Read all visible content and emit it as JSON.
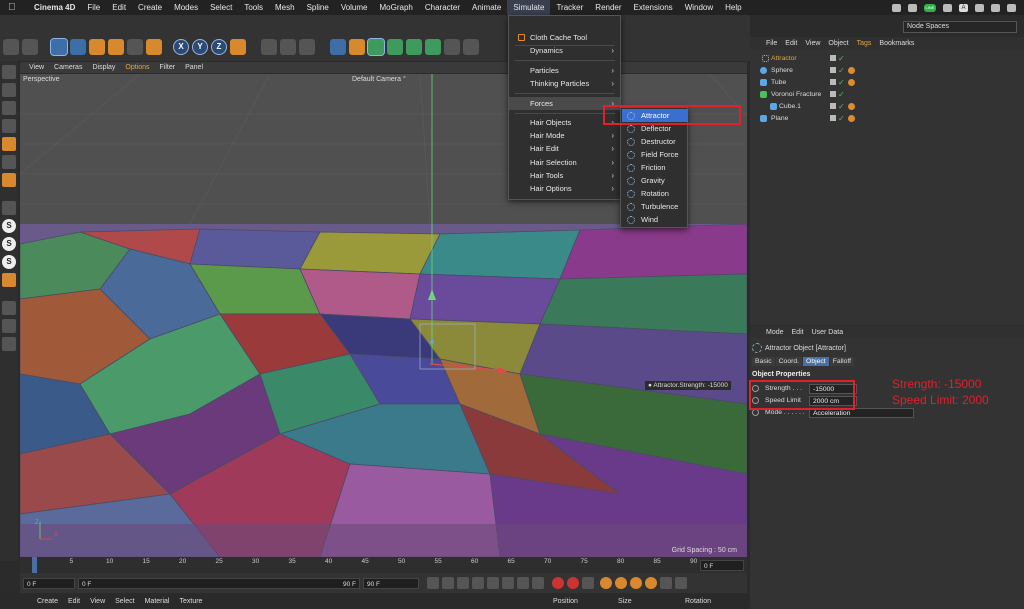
{
  "menubar": {
    "app": "Cinema 4D",
    "items": [
      "File",
      "Edit",
      "Create",
      "Modes",
      "Select",
      "Tools",
      "Mesh",
      "Spline",
      "Volume",
      "MoGraph",
      "Character",
      "Animate",
      "Simulate",
      "Tracker",
      "Render",
      "Extensions",
      "Window",
      "Help"
    ],
    "active": "Simulate",
    "badge_text": "LINE",
    "a_badge": "A"
  },
  "toolbar": {
    "axis_x": "X",
    "axis_y": "Y",
    "axis_z": "Z"
  },
  "node_spaces": "Node Spaces",
  "viewport": {
    "menu": [
      "View",
      "Cameras",
      "Display",
      "Options",
      "Filter",
      "Panel"
    ],
    "highlighted_menu": "Options",
    "perspective": "Perspective",
    "camera": "Default Camera °",
    "grid_spacing": "Grid Spacing : 50 cm",
    "hud": "● Attractor.Strength:    -15000",
    "axis_x": "X",
    "axis_z": "Z"
  },
  "simulate_menu": {
    "items": [
      {
        "label": "Cloth Cache Tool",
        "arrow": "",
        "icon": true
      },
      {
        "label": "Dynamics",
        "arrow": "›"
      },
      {
        "label": "Particles",
        "arrow": "›"
      },
      {
        "label": "Thinking Particles",
        "arrow": "›"
      },
      {
        "label": "Forces",
        "arrow": "›",
        "highlighted": true
      },
      {
        "label": "Hair Objects",
        "arrow": "›"
      },
      {
        "label": "Hair Mode",
        "arrow": "›"
      },
      {
        "label": "Hair Edit",
        "arrow": "›"
      },
      {
        "label": "Hair Selection",
        "arrow": "›"
      },
      {
        "label": "Hair Tools",
        "arrow": "›"
      },
      {
        "label": "Hair Options",
        "arrow": "›"
      }
    ]
  },
  "forces_menu": {
    "items": [
      "Attractor",
      "Deflector",
      "Destructor",
      "Field Force",
      "Friction",
      "Gravity",
      "Rotation",
      "Turbulence",
      "Wind"
    ],
    "highlighted": "Attractor"
  },
  "object_manager": {
    "menu": [
      "File",
      "Edit",
      "View",
      "Object",
      "Tags",
      "Bookmarks"
    ],
    "highlighted_menu": "Tags",
    "objects": [
      {
        "name": "Attractor",
        "selected": true,
        "color": "#8fb3e0",
        "indent": 0,
        "tag": false
      },
      {
        "name": "Sphere",
        "color": "#5aa8e8",
        "indent": 1,
        "tag": true
      },
      {
        "name": "Tube",
        "color": "#5aa8e8",
        "indent": 1,
        "tag": true
      },
      {
        "name": "Voronoi Fracture",
        "color": "#4cbf5a",
        "indent": 1,
        "tag": false
      },
      {
        "name": "Cube.1",
        "color": "#5aa8e8",
        "indent": 2,
        "tag": true
      },
      {
        "name": "Plane",
        "color": "#5aa8e8",
        "indent": 1,
        "tag": true
      }
    ]
  },
  "attribute_manager": {
    "menu": [
      "Mode",
      "Edit",
      "User Data"
    ],
    "title": "Attractor Object [Attractor]",
    "tabs": [
      "Basic",
      "Coord.",
      "Object",
      "Falloff"
    ],
    "active_tab": "Object",
    "section": "Object Properties",
    "properties": [
      {
        "label": "Strength . . .",
        "value": "-15000"
      },
      {
        "label": "Speed Limit",
        "value": "2000 cm"
      },
      {
        "label": "Mode . . . . . .",
        "value": "Acceleration"
      }
    ]
  },
  "annotation": {
    "line1": "Strength: -15000",
    "line2": "Speed Limit: 2000"
  },
  "timeline": {
    "ticks": [
      "0",
      "5",
      "10",
      "15",
      "20",
      "25",
      "30",
      "35",
      "40",
      "45",
      "50",
      "55",
      "60",
      "65",
      "70",
      "75",
      "80",
      "85",
      "90"
    ],
    "current_frame": "0 F",
    "start": "0 F",
    "range_start": "0 F",
    "range_end": "90 F",
    "end": "90 F"
  },
  "bottom": {
    "menu": [
      "Create",
      "Edit",
      "View",
      "Select",
      "Material",
      "Texture"
    ],
    "coords": [
      "Position",
      "Size",
      "Rotation"
    ]
  },
  "colors": {
    "accent_blue": "#3a6fd0",
    "annotation_red": "#e0202a",
    "selected_orange": "#e3a640"
  }
}
